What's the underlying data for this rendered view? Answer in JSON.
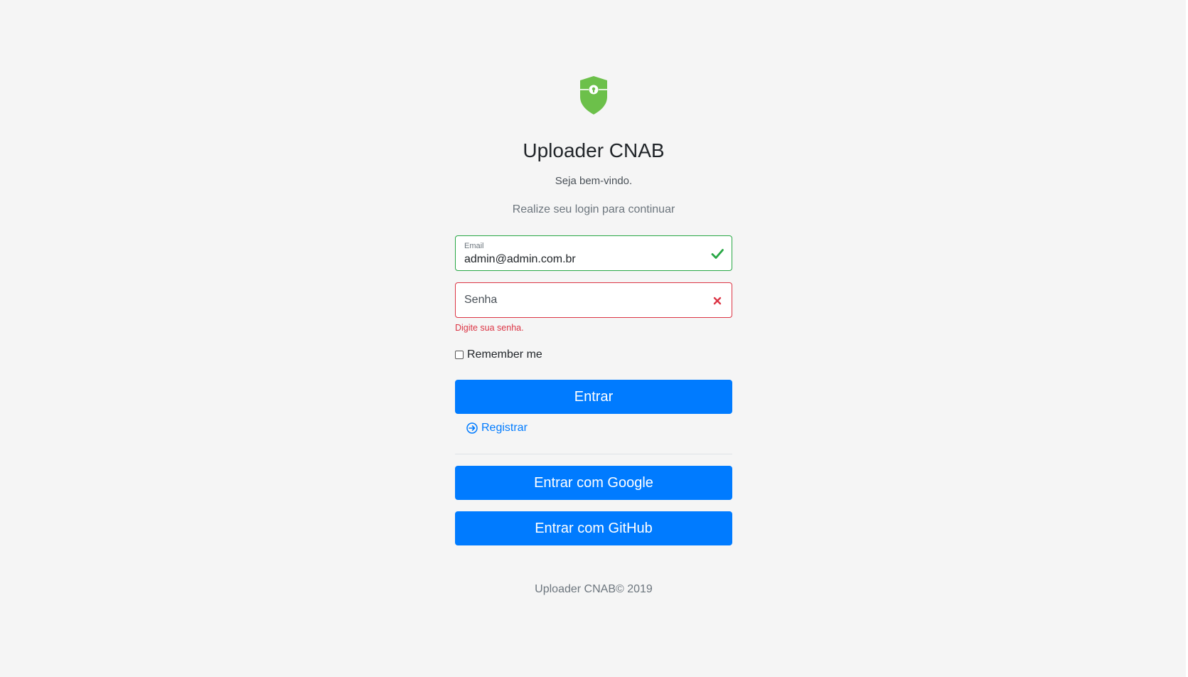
{
  "brand": {
    "title": "Uploader CNAB",
    "logo_icon": "shield-lock-icon",
    "logo_color": "#6cc04a"
  },
  "intro": {
    "welcome": "Seja bem-vindo.",
    "instruction": "Realize seu login para continuar"
  },
  "form": {
    "email": {
      "label": "Email",
      "value": "admin@admin.com.br",
      "status_icon": "check-icon",
      "status_color": "#28a745"
    },
    "password": {
      "placeholder": "Senha",
      "value": "",
      "status_icon": "x-icon",
      "status_color": "#dc3545",
      "error": "Digite sua senha."
    },
    "remember_label": "Remember me",
    "remember_checked": false,
    "submit_label": "Entrar",
    "register_label": "Registrar",
    "register_icon": "arrow-circle-right-icon"
  },
  "social": {
    "google_label": "Entrar com Google",
    "github_label": "Entrar com GitHub"
  },
  "footer": {
    "text": "Uploader CNAB© 2019"
  },
  "colors": {
    "primary": "#007bff",
    "background": "#f5f5f5",
    "valid": "#28a745",
    "invalid": "#dc3545"
  }
}
